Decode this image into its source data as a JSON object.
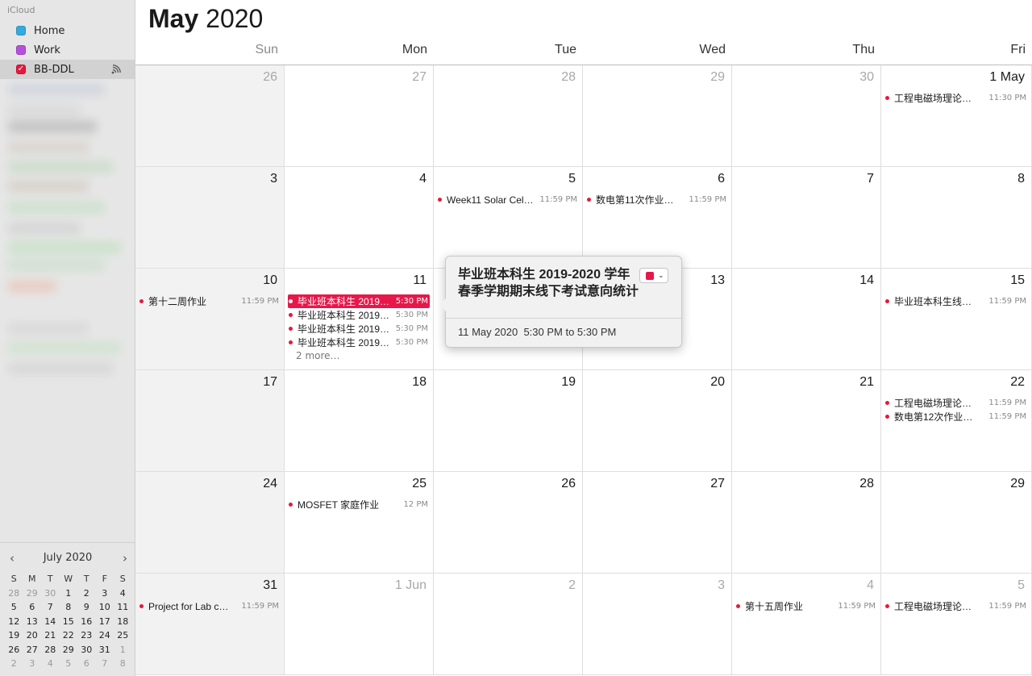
{
  "sidebar": {
    "group": "iCloud",
    "calendars": [
      {
        "label": "Home",
        "color": "#35aadc"
      },
      {
        "label": "Work",
        "color": "#b450dc"
      },
      {
        "label": "BB-DDL",
        "color": "#e8173f"
      }
    ]
  },
  "mini_calendar": {
    "month": "July 2020",
    "prev": "‹",
    "next": "›",
    "weekdays": [
      "S",
      "M",
      "T",
      "W",
      "T",
      "F",
      "S"
    ],
    "weeks": [
      [
        "28",
        "29",
        "30",
        "1",
        "2",
        "3",
        "4"
      ],
      [
        "5",
        "6",
        "7",
        "8",
        "9",
        "10",
        "11"
      ],
      [
        "12",
        "13",
        "14",
        "15",
        "16",
        "17",
        "18"
      ],
      [
        "19",
        "20",
        "21",
        "22",
        "23",
        "24",
        "25"
      ],
      [
        "26",
        "27",
        "28",
        "29",
        "30",
        "31",
        "1"
      ],
      [
        "2",
        "3",
        "4",
        "5",
        "6",
        "7",
        "8"
      ]
    ]
  },
  "calendar": {
    "month": "May",
    "year": "2020",
    "weekdays": [
      "Sun",
      "Mon",
      "Tue",
      "Wed",
      "Thu",
      "Fri"
    ],
    "weeks": [
      [
        {
          "label": "26",
          "dim": true,
          "events": []
        },
        {
          "label": "27",
          "dim": true,
          "events": []
        },
        {
          "label": "28",
          "dim": true,
          "events": []
        },
        {
          "label": "29",
          "dim": true,
          "events": []
        },
        {
          "label": "30",
          "dim": true,
          "events": []
        },
        {
          "label": "1 May",
          "events": [
            {
              "title": "工程电磁场理论…",
              "time": "11:30 PM"
            }
          ]
        }
      ],
      [
        {
          "label": "3",
          "events": []
        },
        {
          "label": "4",
          "events": []
        },
        {
          "label": "5",
          "events": [
            {
              "title": "Week11 Solar Cel…",
              "time": "11:59 PM"
            }
          ]
        },
        {
          "label": "6",
          "events": [
            {
              "title": "数电第11次作业…",
              "time": "11:59 PM"
            }
          ]
        },
        {
          "label": "7",
          "events": []
        },
        {
          "label": "8",
          "events": []
        }
      ],
      [
        {
          "label": "10",
          "events": [
            {
              "title": "第十二周作业",
              "time": "11:59 PM"
            }
          ]
        },
        {
          "label": "11",
          "events": [
            {
              "title": "毕业班本科生 2019…",
              "time": "5:30 PM",
              "selected": true
            },
            {
              "title": "毕业班本科生 2019…",
              "time": "5:30 PM"
            },
            {
              "title": "毕业班本科生 2019…",
              "time": "5:30 PM"
            },
            {
              "title": "毕业班本科生 2019…",
              "time": "5:30 PM"
            }
          ],
          "more": "2 more…"
        },
        {
          "label": "12",
          "events": []
        },
        {
          "label": "13",
          "events": []
        },
        {
          "label": "14",
          "events": []
        },
        {
          "label": "15",
          "events": [
            {
              "title": "毕业班本科生线…",
              "time": "11:59 PM"
            }
          ]
        }
      ],
      [
        {
          "label": "17",
          "events": []
        },
        {
          "label": "18",
          "events": []
        },
        {
          "label": "19",
          "events": []
        },
        {
          "label": "20",
          "events": []
        },
        {
          "label": "21",
          "events": []
        },
        {
          "label": "22",
          "events": [
            {
              "title": "工程电磁场理论…",
              "time": "11:59 PM"
            },
            {
              "title": "数电第12次作业…",
              "time": "11:59 PM"
            }
          ]
        }
      ],
      [
        {
          "label": "24",
          "events": []
        },
        {
          "label": "25",
          "events": [
            {
              "title": "MOSFET 家庭作业",
              "time": "12 PM"
            }
          ]
        },
        {
          "label": "26",
          "events": []
        },
        {
          "label": "27",
          "events": []
        },
        {
          "label": "28",
          "events": []
        },
        {
          "label": "29",
          "events": []
        }
      ],
      [
        {
          "label": "31",
          "events": [
            {
              "title": "Project for Lab c…",
              "time": "11:59 PM"
            }
          ]
        },
        {
          "label": "1 Jun",
          "dim": true,
          "events": []
        },
        {
          "label": "2",
          "dim": true,
          "events": []
        },
        {
          "label": "3",
          "dim": true,
          "events": []
        },
        {
          "label": "4",
          "dim": true,
          "events": [
            {
              "title": "第十五周作业",
              "time": "11:59 PM"
            }
          ]
        },
        {
          "label": "5",
          "dim": true,
          "events": [
            {
              "title": "工程电磁场理论…",
              "time": "11:59 PM"
            }
          ]
        }
      ]
    ]
  },
  "popover": {
    "title": "毕业班本科生 2019-2020 学年春季学期期末线下考试意向统计",
    "date": "11 May 2020",
    "time_range": "5:30 PM to 5:30 PM",
    "color": "#e8174a"
  }
}
